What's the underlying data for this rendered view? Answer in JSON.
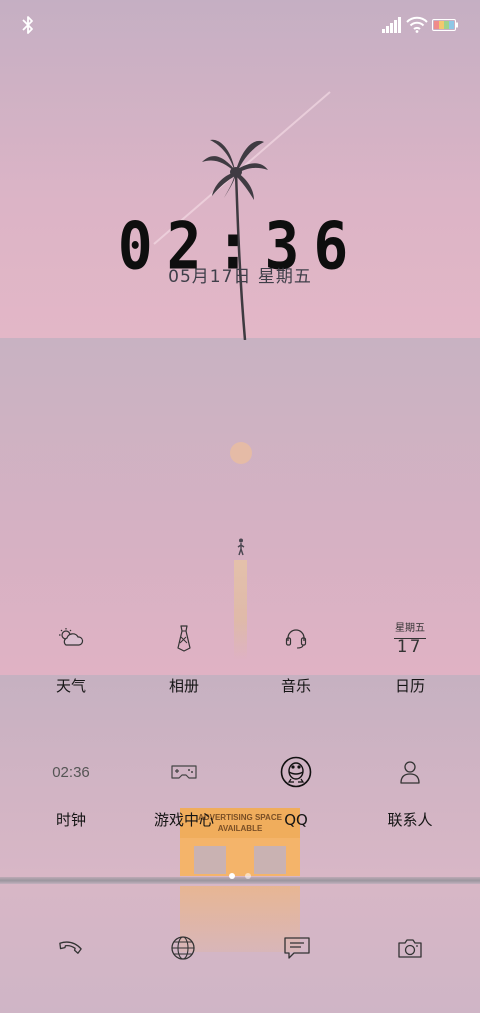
{
  "lockscreen": {
    "time": "02:36",
    "date": "05月17日 星期五"
  },
  "billboard": {
    "line1": "ADVERTISING SPACE",
    "line2": "AVAILABLE"
  },
  "apps_row1": [
    {
      "label": "天气",
      "icon": "weather-icon"
    },
    {
      "label": "相册",
      "icon": "gallery-icon"
    },
    {
      "label": "音乐",
      "icon": "music-icon"
    },
    {
      "label": "日历",
      "icon": "calendar-icon",
      "weekday": "星期五",
      "day": "17"
    }
  ],
  "apps_row2": [
    {
      "label": "时钟",
      "icon": "clock-icon",
      "icon_text": "02:36"
    },
    {
      "label": "游戏中心",
      "icon": "gamepad-icon"
    },
    {
      "label": "QQ",
      "icon": "qq-icon"
    },
    {
      "label": "联系人",
      "icon": "contacts-icon"
    }
  ],
  "dock": [
    "phone-icon",
    "browser-icon",
    "messages-icon",
    "camera-icon"
  ],
  "page_indicator": {
    "pages": 2,
    "current": 1
  },
  "colors": {
    "accent_text": "#151515",
    "sun": "#e5bba6",
    "billboard": "#f0ad5c"
  }
}
